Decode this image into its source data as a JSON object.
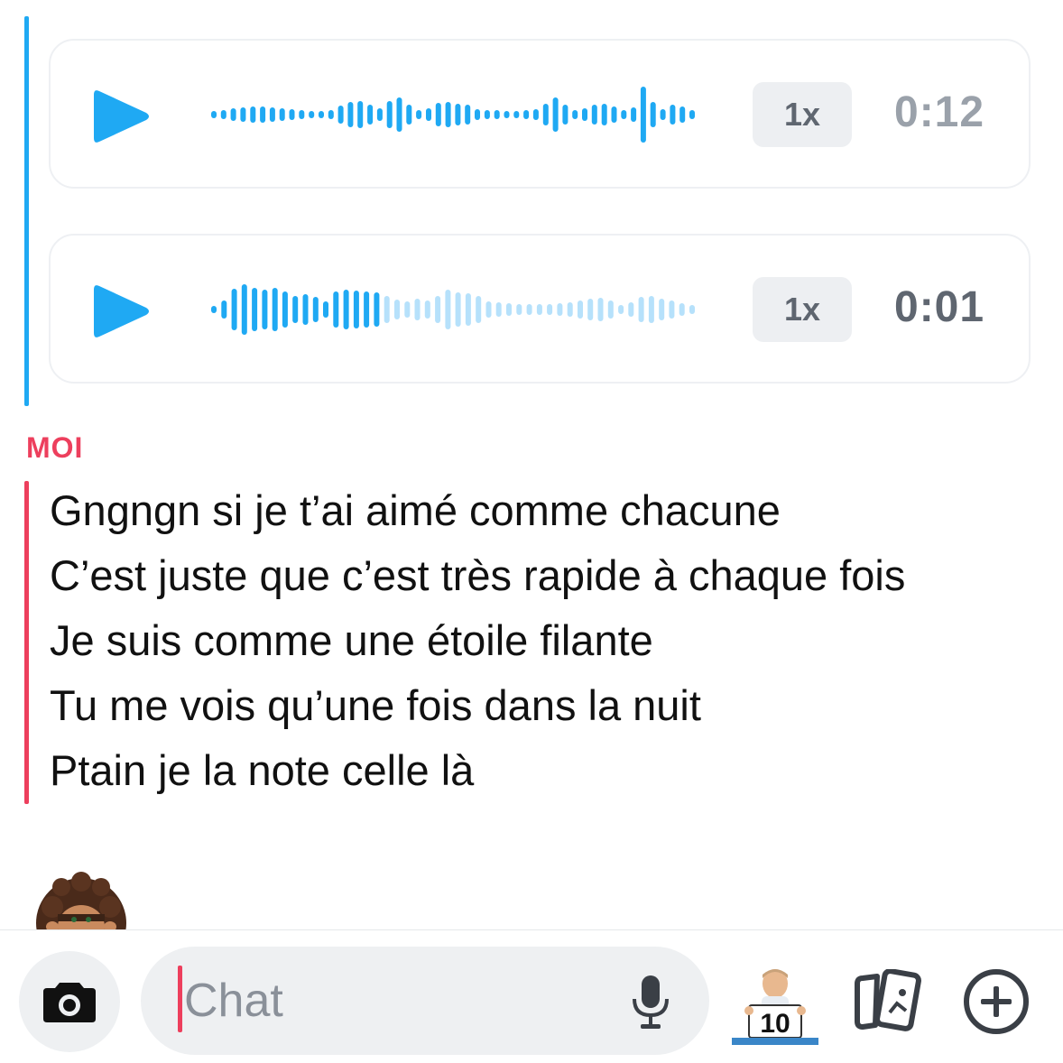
{
  "voice_notes": [
    {
      "speed_label": "1x",
      "duration": "0:12",
      "icon": "play-icon",
      "played_fraction": 1.0
    },
    {
      "speed_label": "1x",
      "duration": "0:01",
      "icon": "play-icon",
      "played_fraction": 0.36
    }
  ],
  "message": {
    "sender": "MOI",
    "lines": [
      "Gngngn si je t’ai aimé comme chacune",
      "C’est juste que c’est très rapide à chaque fois",
      "Je suis comme une étoile filante",
      "Tu me vois qu’une fois dans la nuit",
      "Ptain je la note celle là"
    ]
  },
  "composer": {
    "placeholder": "Chat",
    "bitmoji_sign": "10",
    "icons": [
      "camera-icon",
      "microphone-icon",
      "bitmoji-sticker-icon",
      "cards-icon",
      "plus-circle-icon"
    ]
  },
  "colors": {
    "friend_accent": "#1fa9f3",
    "self_accent": "#ed3f5d",
    "wave_unplayed": "#b6e1fb"
  }
}
